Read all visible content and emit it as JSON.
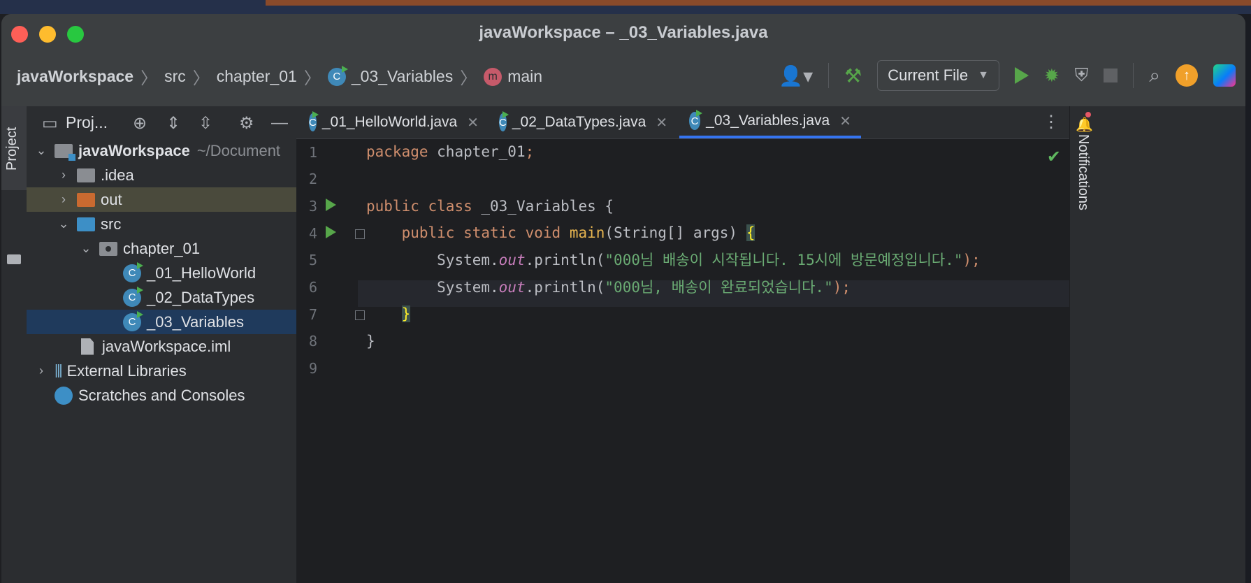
{
  "window": {
    "title": "javaWorkspace – _03_Variables.java"
  },
  "breadcrumb": [
    {
      "label": "javaWorkspace"
    },
    {
      "label": "src"
    },
    {
      "label": "chapter_01"
    },
    {
      "label": "_03_Variables",
      "icon": "class-icon"
    },
    {
      "label": "main",
      "icon": "method-icon"
    }
  ],
  "toolbar": {
    "run_config": "Current File",
    "icons": [
      "user-icon",
      "build-hammer-icon",
      "run-icon",
      "debug-icon",
      "coverage-icon",
      "stop-icon",
      "search-icon",
      "update-icon",
      "jetbrains-icon"
    ]
  },
  "left_strip": {
    "project_label": "Project"
  },
  "project_panel": {
    "title": "Proj...",
    "tree": [
      {
        "label": "javaWorkspace",
        "path": "~/Document",
        "expanded": true
      },
      {
        "label": ".idea",
        "expanded": false
      },
      {
        "label": "out",
        "expanded": false
      },
      {
        "label": "src",
        "expanded": true
      },
      {
        "label": "chapter_01",
        "expanded": true
      },
      {
        "label": "_01_HelloWorld"
      },
      {
        "label": "_02_DataTypes"
      },
      {
        "label": "_03_Variables",
        "selected": true
      },
      {
        "label": "javaWorkspace.iml"
      },
      {
        "label": "External Libraries",
        "expanded": false
      },
      {
        "label": "Scratches and Consoles"
      }
    ]
  },
  "editor": {
    "tabs": [
      {
        "label": "_01_HelloWorld.java"
      },
      {
        "label": "_02_DataTypes.java"
      },
      {
        "label": "_03_Variables.java",
        "active": true
      }
    ],
    "line_numbers": [
      "1",
      "2",
      "3",
      "4",
      "5",
      "6",
      "7",
      "8",
      "9"
    ],
    "code": {
      "l1": {
        "kw": "package",
        "name": " chapter_01",
        "semi": ";"
      },
      "l3": {
        "kw1": "public",
        "kw2": "class",
        "name": " _03_Variables {"
      },
      "l4": {
        "indent": "    ",
        "kw1": "public",
        "kw2": "static",
        "kw3": "void",
        "method": "main",
        "params": "(String[] args) ",
        "brace": "{"
      },
      "l5": {
        "indent": "        ",
        "obj": "System.",
        "field": "out",
        "call": ".println(",
        "str": "\"000님 배송이 시작됩니다. 15시에 방문예정입니다.\"",
        "end": ");"
      },
      "l6": {
        "indent": "        ",
        "obj": "System.",
        "field": "out",
        "call": ".println(",
        "str": "\"000님, 배송이 완료되었습니다.\"",
        "end": ");"
      },
      "l7": {
        "indent": "    ",
        "brace": "}"
      },
      "l8": {
        "brace": "}"
      }
    }
  },
  "right_strip": {
    "notifications_label": "Notifications"
  },
  "colors": {
    "accent": "#3574f0",
    "keyword": "#cf8e6d",
    "string": "#6aab73",
    "method": "#e6b450",
    "field": "#c77dbb"
  }
}
